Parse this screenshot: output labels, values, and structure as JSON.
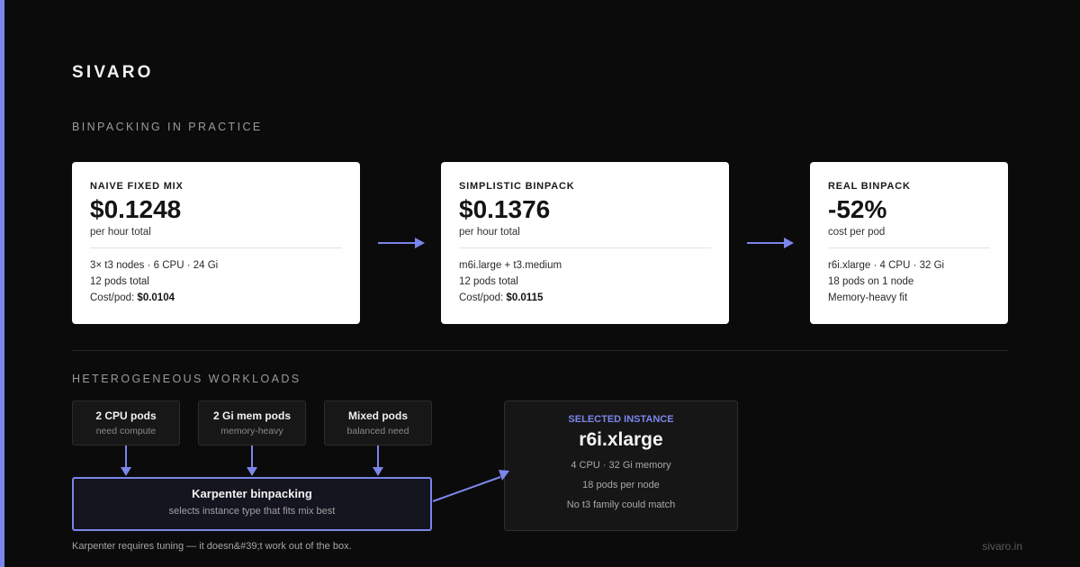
{
  "brand": "SIVARO",
  "accent_color": "#7b86ea",
  "sections": {
    "binpacking": "BINPACKING IN PRACTICE",
    "workloads": "HETEROGENEOUS WORKLOADS"
  },
  "cards": [
    {
      "title": "NAIVE FIXED MIX",
      "value": "$0.1248",
      "sub": "per hour total",
      "lines": [
        "3× t3 nodes · 6 CPU · 24 Gi",
        "12 pods total"
      ],
      "cost_label": "Cost/pod: ",
      "cost_value": "$0.0104"
    },
    {
      "title": "SIMPLISTIC BINPACK",
      "value": "$0.1376",
      "sub": "per hour total",
      "lines": [
        "m6i.large + t3.medium",
        "12 pods total"
      ],
      "cost_label": "Cost/pod: ",
      "cost_value": "$0.0115"
    },
    {
      "title": "REAL BINPACK",
      "value": "-52%",
      "sub": "cost per pod",
      "lines": [
        "r6i.xlarge · 4 CPU · 32 Gi",
        "18 pods on 1 node",
        "Memory-heavy fit"
      ]
    }
  ],
  "pods": [
    {
      "title": "2 CPU pods",
      "sub": "need compute"
    },
    {
      "title": "2 Gi mem pods",
      "sub": "memory-heavy"
    },
    {
      "title": "Mixed pods",
      "sub": "balanced need"
    }
  ],
  "karpenter": {
    "title": "Karpenter binpacking",
    "sub": "selects instance type that fits mix best"
  },
  "selected": {
    "label": "SELECTED INSTANCE",
    "value": "r6i.xlarge",
    "lines": [
      "4 CPU · 32 Gi memory",
      "18 pods per node",
      "No t3 family could match"
    ]
  },
  "footnote": "Karpenter requires tuning — it doesn&#39;t work out of the box.",
  "site": "sivaro.in"
}
